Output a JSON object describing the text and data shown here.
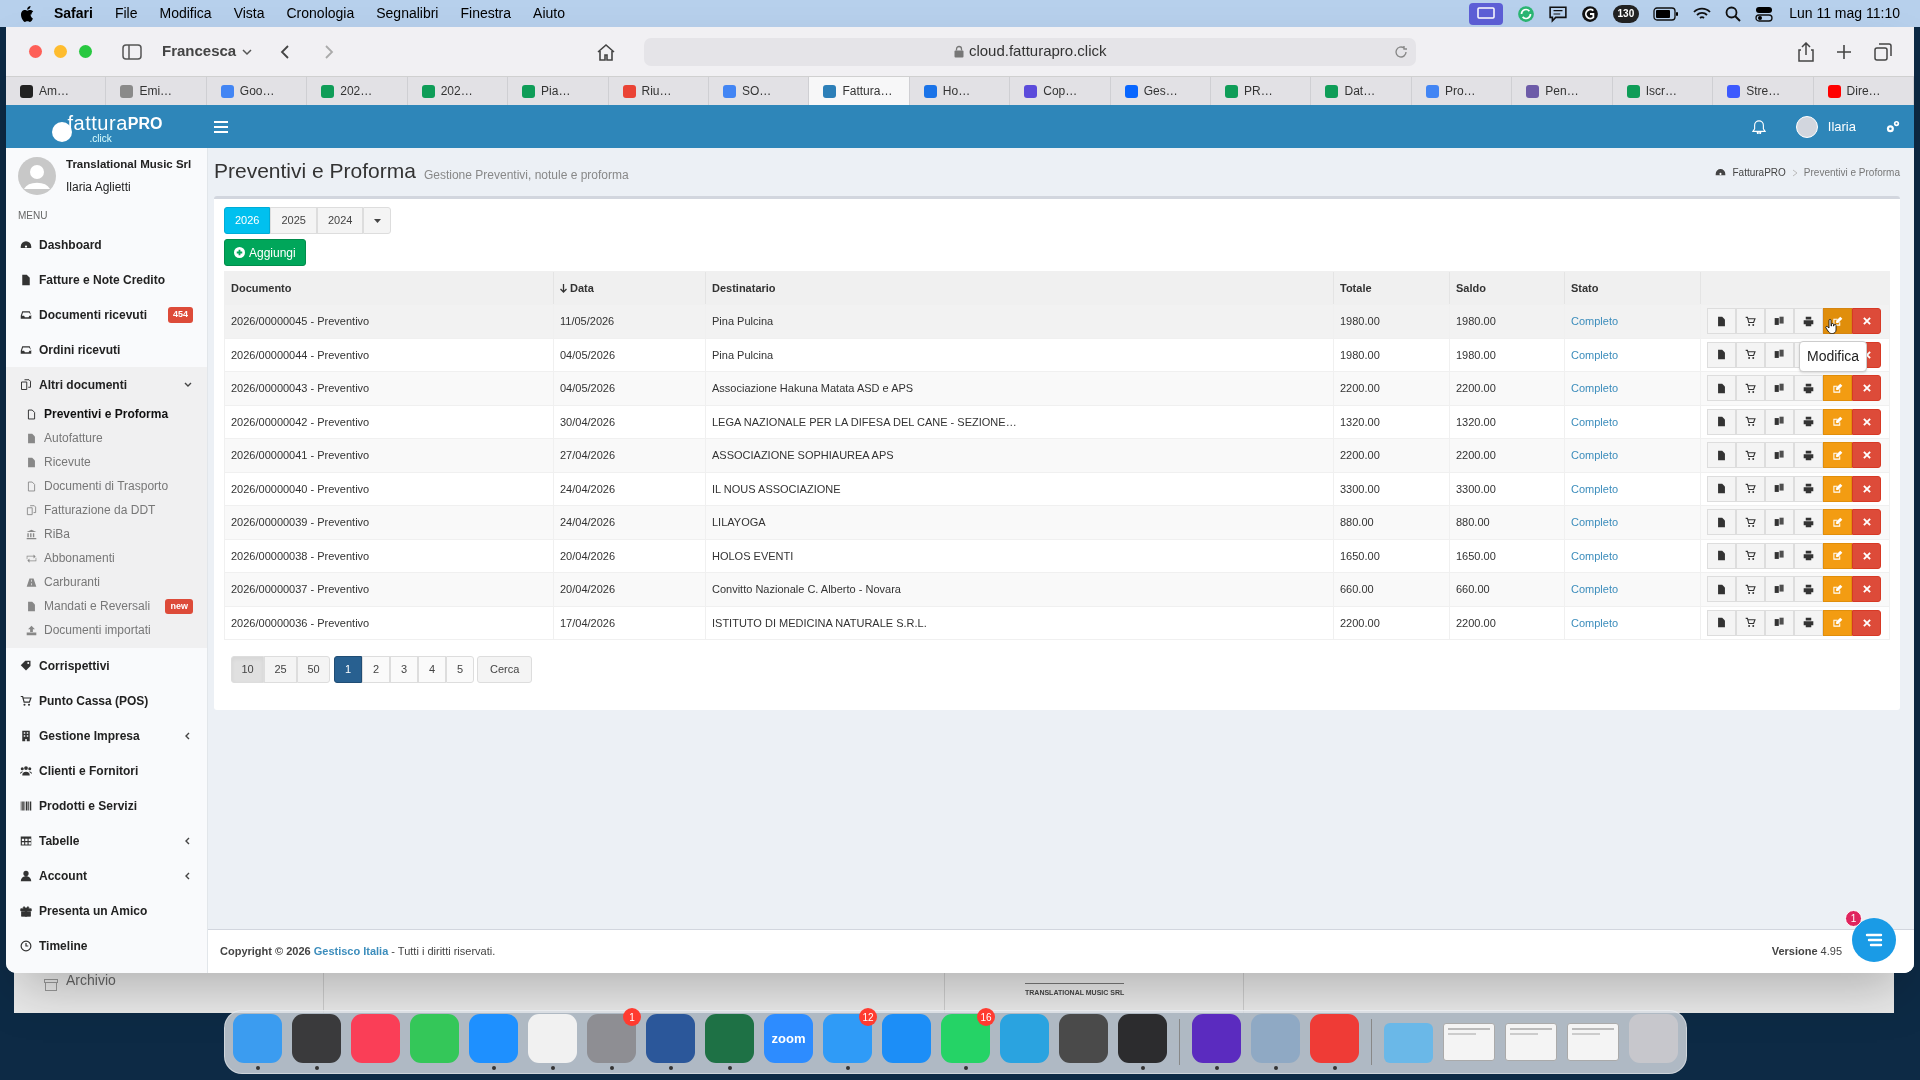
{
  "menu_bar": {
    "app": "Safari",
    "menus": [
      "File",
      "Modifica",
      "Vista",
      "Cronologia",
      "Segnalibri",
      "Finestra",
      "Aiuto"
    ],
    "status_badge": "130",
    "clock": "Lun 11 mag 11:10"
  },
  "browser": {
    "profile": "Francesca",
    "url": "cloud.fatturapro.click",
    "tabs": [
      {
        "label": "Am…",
        "selected": false,
        "color": "#222222"
      },
      {
        "label": "Emi…",
        "selected": false,
        "color": "#8a8a8a"
      },
      {
        "label": "Goo…",
        "selected": false,
        "color": "#4285f4"
      },
      {
        "label": "202…",
        "selected": false,
        "color": "#0f9d58"
      },
      {
        "label": "202…",
        "selected": false,
        "color": "#0f9d58"
      },
      {
        "label": "Pia…",
        "selected": false,
        "color": "#0f9d58"
      },
      {
        "label": "Riu…",
        "selected": false,
        "color": "#ea4335"
      },
      {
        "label": "SO…",
        "selected": false,
        "color": "#4285f4"
      },
      {
        "label": "Fattura…",
        "selected": true,
        "color": "#2c7fb8"
      },
      {
        "label": "Ho…",
        "selected": false,
        "color": "#1a73e8"
      },
      {
        "label": "Cop…",
        "selected": false,
        "color": "#5b4bdb"
      },
      {
        "label": "Ges…",
        "selected": false,
        "color": "#0866ff"
      },
      {
        "label": "PR…",
        "selected": false,
        "color": "#0f9d58"
      },
      {
        "label": "Dat…",
        "selected": false,
        "color": "#0f9d58"
      },
      {
        "label": "Pro…",
        "selected": false,
        "color": "#4285f4"
      },
      {
        "label": "Pen…",
        "selected": false,
        "color": "#6d5ba8"
      },
      {
        "label": "Iscr…",
        "selected": false,
        "color": "#0f9d58"
      },
      {
        "label": "Stre…",
        "selected": false,
        "color": "#3d5afe"
      },
      {
        "label": "Dire…",
        "selected": false,
        "color": "#ff0000"
      }
    ]
  },
  "app_header": {
    "logo_main": "fattura",
    "logo_strong": "PRO",
    "logo_sub": ".click",
    "user": "Ilaria"
  },
  "sidebar": {
    "company": "Translational Music Srl",
    "user": "Ilaria Aglietti",
    "section": "MENU",
    "items": [
      {
        "label": "Dashboard"
      },
      {
        "label": "Fatture e Note Credito"
      },
      {
        "label": "Documenti ricevuti",
        "badge": "454"
      },
      {
        "label": "Ordini ricevuti"
      },
      {
        "label": "Altri documenti",
        "expanded": true,
        "children": [
          {
            "label": "Preventivi e Proforma",
            "selected": true
          },
          {
            "label": "Autofatture",
            "selected": false
          },
          {
            "label": "Ricevute",
            "selected": false
          },
          {
            "label": "Documenti di Trasporto",
            "selected": false
          },
          {
            "label": "Fatturazione da DDT",
            "selected": false
          },
          {
            "label": "RiBa",
            "selected": false
          },
          {
            "label": "Abbonamenti",
            "selected": false
          },
          {
            "label": "Carburanti",
            "selected": false
          },
          {
            "label": "Mandati e Reversali",
            "selected": false,
            "badge": "new"
          },
          {
            "label": "Documenti importati",
            "selected": false
          }
        ]
      },
      {
        "label": "Corrispettivi"
      },
      {
        "label": "Punto Cassa (POS)"
      },
      {
        "label": "Gestione Impresa",
        "expanded": false
      },
      {
        "label": "Clienti e Fornitori"
      },
      {
        "label": "Prodotti e Servizi"
      },
      {
        "label": "Tabelle",
        "expanded": false
      },
      {
        "label": "Account",
        "expanded": false
      },
      {
        "label": "Presenta un Amico"
      },
      {
        "label": "Timeline"
      }
    ]
  },
  "page": {
    "title": "Preventivi e Proforma",
    "subtitle": "Gestione Preventivi, notule e proforma",
    "breadcrumb": [
      "FatturaPRO",
      "Preventivi e Proforma"
    ]
  },
  "years": [
    {
      "label": "2026",
      "selected": true
    },
    {
      "label": "2025",
      "selected": false
    },
    {
      "label": "2024",
      "selected": false
    }
  ],
  "add_button": "Aggiungi",
  "table": {
    "columns": [
      {
        "label": "Documento",
        "sorted": false
      },
      {
        "label": "Data",
        "sorted": true
      },
      {
        "label": "Destinatario",
        "sorted": false
      },
      {
        "label": "Totale",
        "sorted": false
      },
      {
        "label": "Saldo",
        "sorted": false
      },
      {
        "label": "Stato",
        "sorted": false
      }
    ],
    "rows": [
      {
        "documento": "2026/00000045 - Preventivo",
        "data": "11/05/2026",
        "destinatario": "Pina Pulcina",
        "totale": "1980.00",
        "saldo": "1980.00",
        "stato": "Completo",
        "edit_hovered": true
      },
      {
        "documento": "2026/00000044 - Preventivo",
        "data": "04/05/2026",
        "destinatario": "Pina Pulcina",
        "totale": "1980.00",
        "saldo": "1980.00",
        "stato": "Completo",
        "edit_hovered": false
      },
      {
        "documento": "2026/00000043 - Preventivo",
        "data": "04/05/2026",
        "destinatario": "Associazione Hakuna Matata ASD e APS",
        "totale": "2200.00",
        "saldo": "2200.00",
        "stato": "Completo",
        "edit_hovered": false
      },
      {
        "documento": "2026/00000042 - Preventivo",
        "data": "30/04/2026",
        "destinatario": "LEGA NAZIONALE PER LA DIFESA DEL CANE - SEZIONE…",
        "totale": "1320.00",
        "saldo": "1320.00",
        "stato": "Completo",
        "edit_hovered": false
      },
      {
        "documento": "2026/00000041 - Preventivo",
        "data": "27/04/2026",
        "destinatario": "ASSOCIAZIONE SOPHIAUREA APS",
        "totale": "2200.00",
        "saldo": "2200.00",
        "stato": "Completo",
        "edit_hovered": false
      },
      {
        "documento": "2026/00000040 - Preventivo",
        "data": "24/04/2026",
        "destinatario": "IL NOUS ASSOCIAZIONE",
        "totale": "3300.00",
        "saldo": "3300.00",
        "stato": "Completo",
        "edit_hovered": false
      },
      {
        "documento": "2026/00000039 - Preventivo",
        "data": "24/04/2026",
        "destinatario": "LILAYOGA",
        "totale": "880.00",
        "saldo": "880.00",
        "stato": "Completo",
        "edit_hovered": false
      },
      {
        "documento": "2026/00000038 - Preventivo",
        "data": "20/04/2026",
        "destinatario": "HOLOS EVENTI",
        "totale": "1650.00",
        "saldo": "1650.00",
        "stato": "Completo",
        "edit_hovered": false
      },
      {
        "documento": "2026/00000037 - Preventivo",
        "data": "20/04/2026",
        "destinatario": "Convitto Nazionale C. Alberto - Novara",
        "totale": "660.00",
        "saldo": "660.00",
        "stato": "Completo",
        "edit_hovered": false
      },
      {
        "documento": "2026/00000036 - Preventivo",
        "data": "17/04/2026",
        "destinatario": "ISTITUTO DI MEDICINA NATURALE S.R.L.",
        "totale": "2200.00",
        "saldo": "2200.00",
        "stato": "Completo",
        "edit_hovered": false
      }
    ]
  },
  "tooltip": "Modifica",
  "page_sizes": [
    {
      "label": "10",
      "selected": true
    },
    {
      "label": "25",
      "selected": false
    },
    {
      "label": "50",
      "selected": false
    }
  ],
  "pages": [
    {
      "label": "1",
      "selected": true
    },
    {
      "label": "2",
      "selected": false
    },
    {
      "label": "3",
      "selected": false
    },
    {
      "label": "4",
      "selected": false
    },
    {
      "label": "5",
      "selected": false
    }
  ],
  "search_button": "Cerca",
  "footer": {
    "copyright": "Copyright © 2026",
    "company_link": "Gestisco Italia",
    "rights": "- Tutti i diritti riservati.",
    "version": "**Versione** 4.95",
    "chat_badge": "1"
  },
  "background_window": {
    "item": "Archivio",
    "heading": "TRANSLATIONAL MUSIC SRL"
  },
  "dock": [
    {
      "kind": "app",
      "color": "#3b9cf0",
      "running": true
    },
    {
      "kind": "app",
      "color": "#3a3a3c",
      "running": true
    },
    {
      "kind": "app",
      "color": "#fa3e57",
      "running": false
    },
    {
      "kind": "app",
      "color": "#34c759",
      "running": false
    },
    {
      "kind": "app",
      "color": "#1e90ff",
      "running": true
    },
    {
      "kind": "app",
      "color": "#f1f1f1",
      "running": true
    },
    {
      "kind": "app",
      "color": "#8e8e93",
      "running": true,
      "badge": "1"
    },
    {
      "kind": "app",
      "color": "#2b579a",
      "running": true
    },
    {
      "kind": "app",
      "color": "#1e7145",
      "running": true
    },
    {
      "kind": "app",
      "color": "#2d8cff",
      "running": false,
      "label": "zoom"
    },
    {
      "kind": "app",
      "color": "#2f9bf7",
      "running": true,
      "badge": "12"
    },
    {
      "kind": "app",
      "color": "#1c8ef7",
      "running": false
    },
    {
      "kind": "app",
      "color": "#25d366",
      "running": true,
      "badge": "16"
    },
    {
      "kind": "app",
      "color": "#2aa3e0",
      "running": false
    },
    {
      "kind": "app",
      "color": "#4a4a4a",
      "running": false
    },
    {
      "kind": "app",
      "color": "#2c2c2e",
      "running": true
    },
    {
      "kind": "separator"
    },
    {
      "kind": "app",
      "color": "#5b2bbf",
      "running": true
    },
    {
      "kind": "app",
      "color": "#8fa9c4",
      "running": true
    },
    {
      "kind": "app",
      "color": "#ef3b36",
      "running": true
    },
    {
      "kind": "separator"
    },
    {
      "kind": "folder",
      "color": "#6ab8e8"
    },
    {
      "kind": "window",
      "color": "#f4f4f4"
    },
    {
      "kind": "window",
      "color": "#f4f4f4"
    },
    {
      "kind": "window",
      "color": "#f4f4f4"
    },
    {
      "kind": "app",
      "color": "#c7c7cc",
      "running": false
    }
  ]
}
